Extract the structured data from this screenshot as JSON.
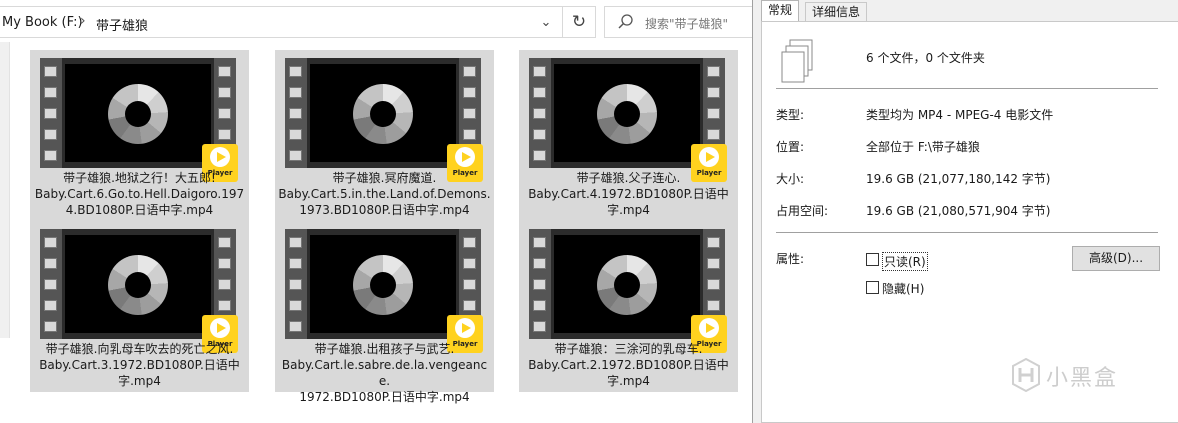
{
  "explorer": {
    "address": {
      "drive": "My Book (F:)",
      "separator": "›",
      "folder": "带子雄狼",
      "dropdown_icon": "chevron-down-icon",
      "refresh_icon": "refresh-icon"
    },
    "search": {
      "placeholder": "搜索\"带子雄狼\"",
      "icon": "search-icon"
    },
    "files": [
      {
        "name": "带子雄狼.地狱之行！大五郎!\nBaby.Cart.6.Go.to.Hell.Daigoro.197\n4.BD1080P.日语中字.mp4",
        "badge": "Player"
      },
      {
        "name": "带子雄狼.冥府魔道.\nBaby.Cart.5.in.the.Land.of.Demons.\n1973.BD1080P.日语中字.mp4",
        "badge": "Player"
      },
      {
        "name": "带子雄狼.父子连心.\nBaby.Cart.4.1972.BD1080P.日语中\n字.mp4",
        "badge": "Player"
      },
      {
        "name": "带子雄狼.向乳母车吹去的死亡之风.\nBaby.Cart.3.1972.BD1080P.日语中\n字.mp4",
        "badge": "Player"
      },
      {
        "name": "带子雄狼.出租孩子与武艺.\nBaby.Cart.le.sabre.de.la.vengeance.\n1972.BD1080P.日语中字.mp4",
        "badge": "Player"
      },
      {
        "name": "带子雄狼：三涂河的乳母车.\nBaby.Cart.2.1972.BD1080P.日语中\n字.mp4",
        "badge": "Player"
      }
    ]
  },
  "properties": {
    "tabs": [
      "常规",
      "详细信息"
    ],
    "summary": "6 个文件，0 个文件夹",
    "type_label": "类型:",
    "type_value": "类型均为 MP4 - MPEG-4 电影文件",
    "location_label": "位置:",
    "location_value": "全部位于 F:\\带子雄狼",
    "size_label": "大小:",
    "size_value": "19.6 GB (21,077,180,142 字节)",
    "disk_label": "占用空间:",
    "disk_value": "19.6 GB (21,080,571,904 字节)",
    "attributes_label": "属性:",
    "readonly_label": "只读(R)",
    "readonly_checked": false,
    "hidden_label": "隐藏(H)",
    "hidden_checked": false,
    "advanced_label": "高级(D)..."
  },
  "watermark": {
    "text": "小黑盒"
  }
}
